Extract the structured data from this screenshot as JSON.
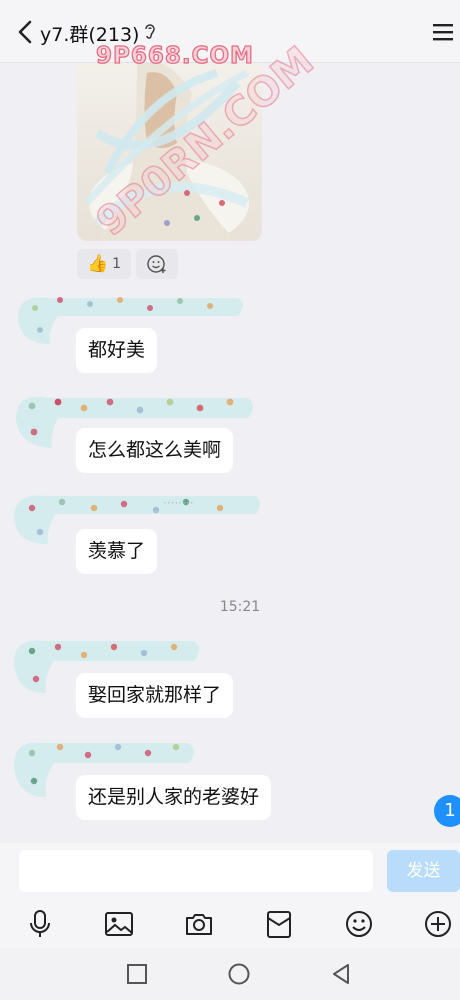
{
  "header": {
    "title": "y7.群(213)",
    "back_icon": "chevron-left-icon",
    "ear_icon": "earpiece-mode-icon",
    "menu_icon": "menu-icon"
  },
  "watermarks": {
    "top": "9P668.COM",
    "diagonal": "9P0RN.COM"
  },
  "photo_message": {
    "reactions": [
      {
        "icon": "thumbs-up-icon",
        "count": "1"
      },
      {
        "icon": "add-reaction-icon"
      }
    ]
  },
  "messages": [
    {
      "text": "都好美"
    },
    {
      "text": "怎么都这么美啊"
    },
    {
      "text": "羡慕了"
    },
    {
      "timestamp": "15:21"
    },
    {
      "text": "娶回家就那样了"
    },
    {
      "text": "还是别人家的老婆好"
    }
  ],
  "unread_badge": "1",
  "input": {
    "placeholder": "",
    "send_label": "发送"
  },
  "toolbar": [
    "mic-icon",
    "image-icon",
    "camera-icon",
    "red-packet-icon",
    "emoji-icon",
    "plus-icon"
  ],
  "navbar": [
    "recent-apps-icon",
    "home-icon",
    "back-triangle-icon"
  ],
  "colors": {
    "background": "#efeff4",
    "accent": "#1e90ff",
    "send_disabled": "#b8dcfa"
  }
}
